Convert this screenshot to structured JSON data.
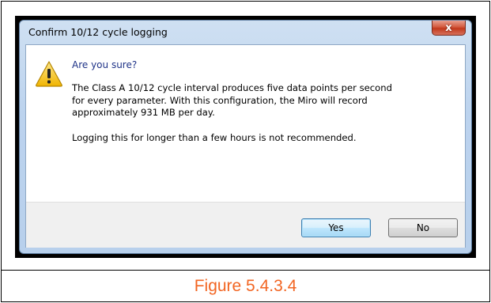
{
  "dialog": {
    "title": "Confirm 10/12 cycle logging",
    "close_glyph": "x",
    "heading": "Are you sure?",
    "message_line1": "The Class A 10/12 cycle interval produces five data points per second",
    "message_line2": "for every parameter. With this configuration, the Miro will record",
    "message_line3": "approximately 931 MB per day.",
    "message_line4": "Logging this for longer than a few hours is not recommended.",
    "icon": "warning-icon",
    "buttons": {
      "yes_label": "Yes",
      "no_label": "No"
    },
    "colors": {
      "heading": "#1e3287",
      "close_button": "#c2391c",
      "warning_icon": "#f5c518"
    }
  },
  "caption": {
    "text": "Figure 5.4.3.4",
    "color": "#f26522"
  }
}
